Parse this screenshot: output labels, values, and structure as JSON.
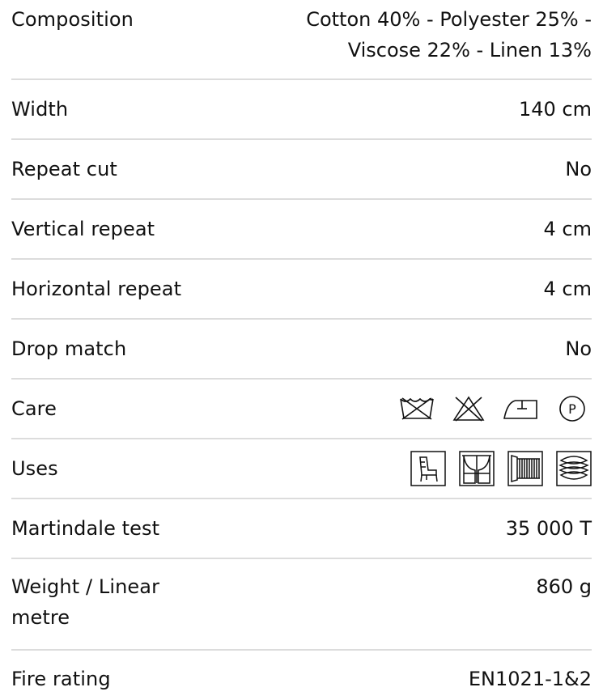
{
  "specs": {
    "composition": {
      "label": "Composition",
      "value_line1": "Cotton 40% - Polyester 25% -",
      "value_line2": "Viscose 22% - Linen 13%"
    },
    "width": {
      "label": "Width",
      "value": "140 cm"
    },
    "repeat_cut": {
      "label": "Repeat cut",
      "value": "No"
    },
    "vertical_repeat": {
      "label": "Vertical repeat",
      "value": "4 cm"
    },
    "horizontal_repeat": {
      "label": "Horizontal repeat",
      "value": "4 cm"
    },
    "drop_match": {
      "label": "Drop match",
      "value": "No"
    },
    "care": {
      "label": "Care",
      "icons": [
        "do-not-wash-icon",
        "do-not-bleach-icon",
        "iron-icon",
        "professional-dry-clean-p-icon"
      ],
      "dry_clean_letter": "P"
    },
    "uses": {
      "label": "Uses",
      "icons": [
        "upholstery-chair-icon",
        "curtains-icon",
        "roman-blind-icon",
        "cushions-icon"
      ]
    },
    "martindale": {
      "label": "Martindale test",
      "value": "35 000 T"
    },
    "weight": {
      "label": "Weight / Linear metre",
      "value": "860 g"
    },
    "fire_rating": {
      "label": "Fire rating",
      "value": "EN1021-1&2"
    }
  },
  "colors": {
    "text": "#111111",
    "divider": "#dcdcdc"
  }
}
